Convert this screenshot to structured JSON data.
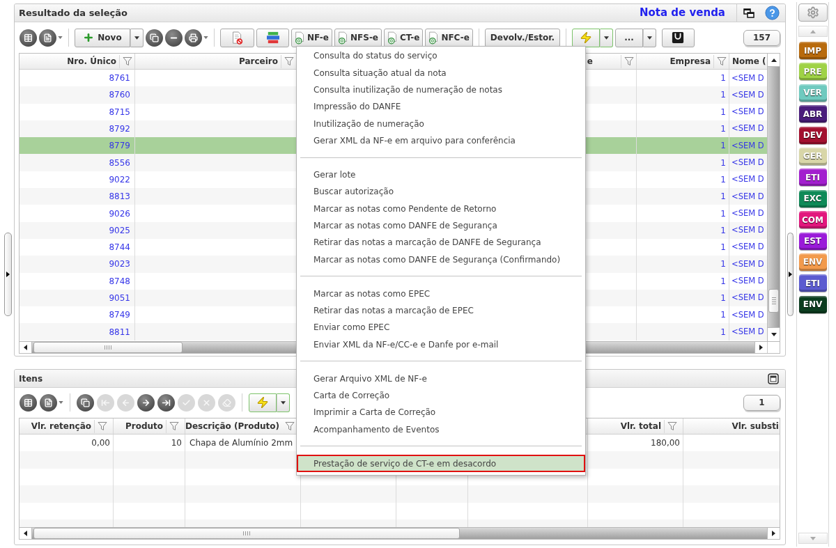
{
  "main_panel": {
    "title": "Resultado da seleção",
    "document_type": "Nota de venda",
    "toolbar": [
      {
        "kind": "grid"
      },
      {
        "kind": "attach"
      },
      {
        "kind": "separator"
      },
      {
        "kind": "new",
        "label": "Novo"
      },
      {
        "kind": "copy"
      },
      {
        "kind": "remove"
      },
      {
        "kind": "stamp"
      },
      {
        "kind": "separator"
      },
      {
        "kind": "cancel"
      },
      {
        "kind": "levels"
      },
      {
        "kind": "doc",
        "label": "NF-e"
      },
      {
        "kind": "doc",
        "label": "NFS-e"
      },
      {
        "kind": "doc",
        "label": "CT-e"
      },
      {
        "kind": "doc",
        "label": "NFC-e"
      },
      {
        "kind": "separator"
      },
      {
        "kind": "text",
        "label": "Devolv./Estor."
      },
      {
        "kind": "separator"
      },
      {
        "kind": "lightning"
      },
      {
        "kind": "more",
        "label": "..."
      },
      {
        "kind": "bag"
      }
    ],
    "record_count": "157",
    "table": {
      "columns": [
        {
          "label": "Nro. Único"
        },
        {
          "label": "Parceiro"
        },
        {
          "label": "e"
        },
        {
          "label": "Empresa"
        },
        {
          "label": "Nome ("
        }
      ],
      "rows": [
        {
          "nro_unico": "8761",
          "empresa": "1",
          "nome": "<SEM D",
          "selected": false
        },
        {
          "nro_unico": "8760",
          "empresa": "1",
          "nome": "<SEM D",
          "selected": false
        },
        {
          "nro_unico": "8715",
          "empresa": "1",
          "nome": "<SEM D",
          "selected": false
        },
        {
          "nro_unico": "8792",
          "empresa": "1",
          "nome": "<SEM D",
          "selected": false
        },
        {
          "nro_unico": "8779",
          "empresa": "1",
          "nome": "<SEM D",
          "selected": true
        },
        {
          "nro_unico": "8556",
          "empresa": "1",
          "nome": "<SEM D",
          "selected": false
        },
        {
          "nro_unico": "9022",
          "empresa": "1",
          "nome": "<SEM D",
          "selected": false
        },
        {
          "nro_unico": "8813",
          "empresa": "1",
          "nome": "<SEM D",
          "selected": false
        },
        {
          "nro_unico": "9026",
          "empresa": "1",
          "nome": "<SEM D",
          "selected": false
        },
        {
          "nro_unico": "9025",
          "empresa": "1",
          "nome": "<SEM D",
          "selected": false
        },
        {
          "nro_unico": "8744",
          "empresa": "1",
          "nome": "<SEM D",
          "selected": false
        },
        {
          "nro_unico": "9023",
          "empresa": "1",
          "nome": "<SEM D",
          "selected": false
        },
        {
          "nro_unico": "8748",
          "empresa": "1",
          "nome": "<SEM D",
          "selected": false
        },
        {
          "nro_unico": "9051",
          "empresa": "1",
          "nome": "<SEM D",
          "selected": false
        },
        {
          "nro_unico": "8749",
          "empresa": "1",
          "nome": "<SEM D",
          "selected": false
        },
        {
          "nro_unico": "8811",
          "empresa": "1",
          "nome": "<SEM D",
          "selected": false
        }
      ]
    }
  },
  "nfe_menu": {
    "groups": [
      {
        "items": [
          {
            "label": "Consulta do status do serviço",
            "selected": false,
            "marked": false
          },
          {
            "label": "Consulta situação atual da nota",
            "selected": false,
            "marked": false
          },
          {
            "label": "Consulta inutilização de numeração de notas",
            "selected": false,
            "marked": false
          },
          {
            "label": "Impressão do DANFE",
            "selected": false,
            "marked": false
          },
          {
            "label": "Inutilização de numeração",
            "selected": false,
            "marked": false
          },
          {
            "label": "Gerar XML da NF-e em arquivo para conferência",
            "selected": false,
            "marked": false
          }
        ]
      },
      {
        "items": [
          {
            "label": "Gerar lote",
            "selected": false,
            "marked": false
          },
          {
            "label": "Buscar autorização",
            "selected": false,
            "marked": false
          },
          {
            "label": "Marcar as notas como Pendente de Retorno",
            "selected": false,
            "marked": false
          },
          {
            "label": "Marcar as notas como DANFE de Segurança",
            "selected": false,
            "marked": false
          },
          {
            "label": "Retirar das notas a marcação de DANFE de Segurança",
            "selected": false,
            "marked": false
          },
          {
            "label": "Marcar as notas como DANFE de Segurança (Confirmando)",
            "selected": false,
            "marked": false
          }
        ]
      },
      {
        "items": [
          {
            "label": "Marcar as notas como EPEC",
            "selected": false,
            "marked": false
          },
          {
            "label": "Retirar das notas a marcação de EPEC",
            "selected": false,
            "marked": false
          },
          {
            "label": "Enviar como EPEC",
            "selected": false,
            "marked": false
          },
          {
            "label": "Enviar XML da NF-e/CC-e e Danfe por e-mail",
            "selected": false,
            "marked": false
          }
        ]
      },
      {
        "items": [
          {
            "label": "Gerar Arquivo XML de NF-e",
            "selected": false,
            "marked": false
          },
          {
            "label": "Carta de Correção",
            "selected": false,
            "marked": false
          },
          {
            "label": "Imprimir a Carta de Correção",
            "selected": false,
            "marked": false
          },
          {
            "label": "Acompanhamento de Eventos",
            "selected": false,
            "marked": false
          }
        ]
      },
      {
        "items": [
          {
            "label": "Prestação de serviço de CT-e em desacordo",
            "selected": true,
            "marked": true
          }
        ]
      }
    ]
  },
  "items_panel": {
    "title": "Itens",
    "toolbar": [
      {
        "kind": "grid",
        "disabled": false
      },
      {
        "kind": "attach",
        "disabled": false
      },
      {
        "kind": "separator"
      },
      {
        "kind": "copy",
        "disabled": false
      },
      {
        "kind": "first",
        "disabled": true
      },
      {
        "kind": "previous",
        "disabled": true
      },
      {
        "kind": "next",
        "disabled": false
      },
      {
        "kind": "last",
        "disabled": false
      },
      {
        "kind": "confirm",
        "disabled": true
      },
      {
        "kind": "discard",
        "disabled": true
      },
      {
        "kind": "eraser",
        "disabled": true
      },
      {
        "kind": "separator"
      },
      {
        "kind": "lightning",
        "disabled": false
      }
    ],
    "record_count": "1",
    "table": {
      "columns": [
        {
          "label": "Vlr. retenção"
        },
        {
          "label": "Produto"
        },
        {
          "label": "Descrição (Produto)"
        },
        {
          "label": "Vlr. total"
        },
        {
          "label": "Vlr. substi"
        }
      ],
      "rows": [
        {
          "vlr_retencao": "0,00",
          "produto": "10",
          "descricao": "Chapa de Alumínio 2mm",
          "vlr_total": "180,00"
        }
      ]
    }
  },
  "tag_sidebar": {
    "tags": [
      {
        "label": "IMP",
        "color": "#b86a0c"
      },
      {
        "label": "PRE",
        "color": "#9fd246"
      },
      {
        "label": "VER",
        "color": "#6fcabf"
      },
      {
        "label": "ABR",
        "color": "#4a1d7c"
      },
      {
        "label": "DEV",
        "color": "#a3102e"
      },
      {
        "label": "GER",
        "color": "#d8d6a8"
      },
      {
        "label": "ETI",
        "color": "#a21fce"
      },
      {
        "label": "EXC",
        "color": "#0f8a58"
      },
      {
        "label": "COM",
        "color": "#e2177d"
      },
      {
        "label": "EST",
        "color": "#9a1ad9"
      },
      {
        "label": "ENV",
        "color": "#f29a4c"
      },
      {
        "label": "ETI",
        "color": "#5b5bd0"
      },
      {
        "label": "ENV",
        "color": "#0c3d1f"
      }
    ]
  }
}
